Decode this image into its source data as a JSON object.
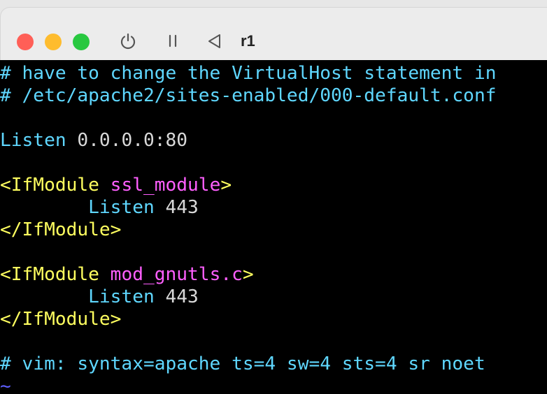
{
  "window": {
    "vm_name": "r1",
    "colors": {
      "close": "#ff5f57",
      "minimize": "#febc2e",
      "zoom": "#28c840"
    },
    "toolbar_icons": [
      "power-icon",
      "pause-icon",
      "back-icon"
    ]
  },
  "terminal": {
    "lines": [
      {
        "comment": "# have to change the VirtualHost statement in"
      },
      {
        "comment": "# /etc/apache2/sites-enabled/000-default.conf"
      },
      {
        "blank": ""
      },
      {
        "keyword": "Listen",
        "value": " 0.0.0.0:80"
      },
      {
        "blank": ""
      },
      {
        "tag_open": "<IfModule ",
        "arg": "ssl_module",
        "tag_close": ">"
      },
      {
        "indent": "        ",
        "keyword": "Listen",
        "value": " 443"
      },
      {
        "tag_open": "</IfModule>"
      },
      {
        "blank": ""
      },
      {
        "tag_open": "<IfModule ",
        "arg": "mod_gnutls.c",
        "tag_close": ">"
      },
      {
        "indent": "        ",
        "keyword": "Listen",
        "value": " 443"
      },
      {
        "tag_open": "</IfModule>"
      },
      {
        "blank": ""
      },
      {
        "comment": "# vim: syntax=apache ts=4 sw=4 sts=4 sr noet"
      },
      {
        "tilde": "~"
      }
    ]
  }
}
